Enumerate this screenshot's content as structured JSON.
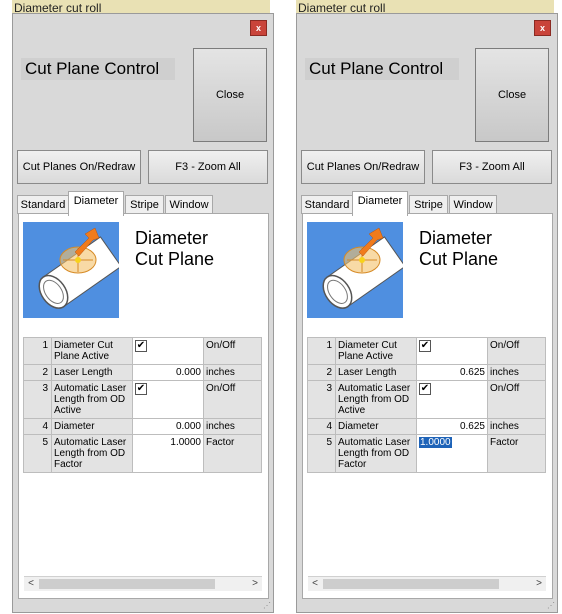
{
  "windows": [
    {
      "bg_title": "Diameter   cut   roll",
      "close_x": "x",
      "title": "Cut Plane Control",
      "close_button": "Close",
      "cut_planes_button": "Cut Planes On/Redraw",
      "zoom_all_button": "F3 - Zoom All",
      "tabs": [
        "Standard",
        "Diameter",
        "Stripe",
        "Window"
      ],
      "active_tab": "Diameter",
      "heading_line1": "Diameter",
      "heading_line2": "Cut Plane",
      "rows": [
        {
          "num": "1",
          "label": "Diameter Cut Plane Active",
          "value": "",
          "checked": true,
          "unit": "On/Off"
        },
        {
          "num": "2",
          "label": "Laser Length",
          "value": "0.000",
          "checked": false,
          "unit": "inches"
        },
        {
          "num": "3",
          "label": "Automatic Laser Length from OD Active",
          "value": "",
          "checked": true,
          "unit": "On/Off"
        },
        {
          "num": "4",
          "label": "Diameter",
          "value": "0.000",
          "checked": false,
          "unit": "inches"
        },
        {
          "num": "5",
          "label": "Automatic Laser Length from OD Factor",
          "value": "1.0000",
          "checked": false,
          "unit": "Factor"
        }
      ]
    },
    {
      "bg_title": "Diameter   cut   roll",
      "close_x": "x",
      "title": "Cut Plane Control",
      "close_button": "Close",
      "cut_planes_button": "Cut Planes On/Redraw",
      "zoom_all_button": "F3 - Zoom All",
      "tabs": [
        "Standard",
        "Diameter",
        "Stripe",
        "Window"
      ],
      "active_tab": "Diameter",
      "heading_line1": "Diameter",
      "heading_line2": "Cut Plane",
      "rows": [
        {
          "num": "1",
          "label": "Diameter Cut Plane Active",
          "value": "",
          "checked": true,
          "unit": "On/Off"
        },
        {
          "num": "2",
          "label": "Laser Length",
          "value": "0.625",
          "checked": false,
          "unit": "inches"
        },
        {
          "num": "3",
          "label": "Automatic Laser Length from OD Active",
          "value": "",
          "checked": true,
          "unit": "On/Off"
        },
        {
          "num": "4",
          "label": "Diameter",
          "value": "0.625",
          "checked": false,
          "unit": "inches"
        },
        {
          "num": "5",
          "label": "Automatic Laser Length from OD Factor",
          "value": "1.0000",
          "checked": false,
          "unit": "Factor",
          "selected": true
        }
      ]
    }
  ],
  "scroll_left": "<",
  "scroll_right": ">",
  "colors": {
    "selection": "#1e63b8",
    "close_x_bg": "#c9443a",
    "image_bg": "#4f8fe0"
  }
}
